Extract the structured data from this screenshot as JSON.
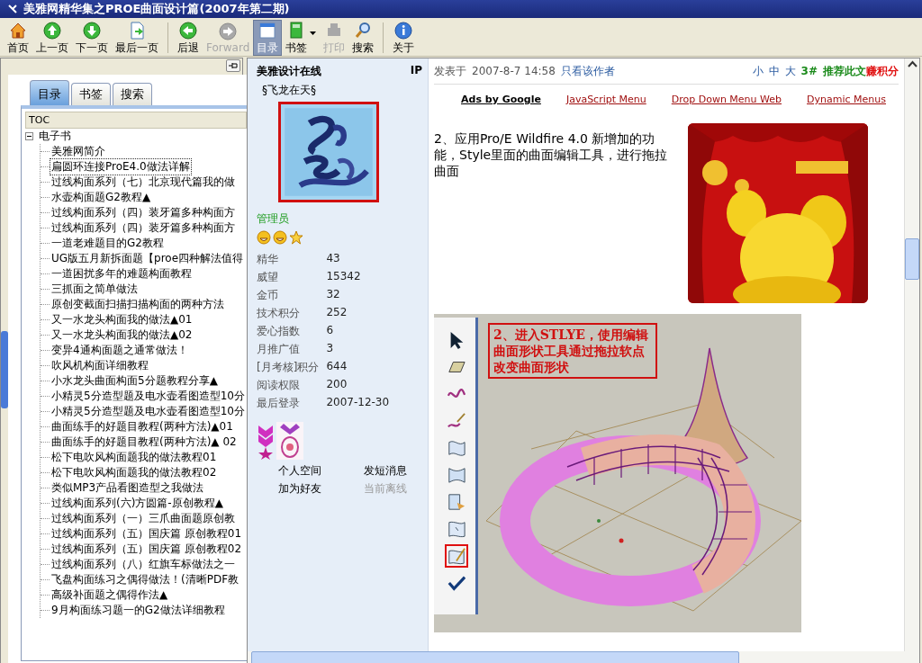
{
  "window": {
    "title": "美雅网精华集之PROE曲面设计篇(2007年第二期)"
  },
  "toolbar": [
    {
      "buttons": [
        {
          "label": "首页",
          "kind": "home",
          "disabled": false,
          "selected": false,
          "dropdown": false
        },
        {
          "label": "上一页",
          "kind": "up",
          "disabled": false,
          "selected": false,
          "dropdown": false
        },
        {
          "label": "下一页",
          "kind": "down",
          "disabled": false,
          "selected": false,
          "dropdown": false
        },
        {
          "label": "最后一页",
          "kind": "last",
          "disabled": false,
          "selected": false,
          "dropdown": false
        }
      ]
    },
    {
      "buttons": [
        {
          "label": "后退",
          "kind": "back",
          "disabled": false,
          "selected": false,
          "dropdown": false
        },
        {
          "label": "Forward",
          "kind": "forward",
          "disabled": true,
          "selected": false,
          "dropdown": false
        },
        {
          "label": "目录",
          "kind": "toc",
          "disabled": false,
          "selected": true,
          "dropdown": false
        },
        {
          "label": "书签",
          "kind": "bookmark",
          "disabled": false,
          "selected": false,
          "dropdown": true
        },
        {
          "label": "打印",
          "kind": "print",
          "disabled": true,
          "selected": false,
          "dropdown": false
        },
        {
          "label": "搜索",
          "kind": "search",
          "disabled": false,
          "selected": false,
          "dropdown": false
        }
      ]
    },
    {
      "buttons": [
        {
          "label": "关于",
          "kind": "about",
          "disabled": false,
          "selected": false,
          "dropdown": false
        }
      ]
    }
  ],
  "sidebar": {
    "tabs": [
      {
        "label": "目录",
        "selected": true
      },
      {
        "label": "书签",
        "selected": false
      },
      {
        "label": "搜索",
        "selected": false
      }
    ],
    "tree_header": "TOC",
    "tree": [
      {
        "label": "电子书",
        "expanded": true,
        "selected": false,
        "children": [
          {
            "label": "美雅网简介",
            "selected": false
          },
          {
            "label": "扁圆环连接ProE4.0做法详解",
            "selected": true
          },
          {
            "label": "过线构面系列（七）北京现代篇我的做",
            "selected": false
          },
          {
            "label": "水壶构面题G2教程▲",
            "selected": false
          },
          {
            "label": "过线构面系列（四）装牙篇多种构面方",
            "selected": false
          },
          {
            "label": "过线构面系列（四）装牙篇多种构面方",
            "selected": false
          },
          {
            "label": "一道老难题目的G2教程",
            "selected": false
          },
          {
            "label": "UG版五月新拆面题【proe四种解法值得",
            "selected": false
          },
          {
            "label": "一道困扰多年的难题构面教程",
            "selected": false
          },
          {
            "label": "三抓面之简单做法",
            "selected": false
          },
          {
            "label": "原创变截面扫描扫描构面的两种方法",
            "selected": false
          },
          {
            "label": "又一水龙头构面我的做法▲01",
            "selected": false
          },
          {
            "label": "又一水龙头构面我的做法▲02",
            "selected": false
          },
          {
            "label": "变异4通构面题之通常做法！",
            "selected": false
          },
          {
            "label": "吹风机构面详细教程",
            "selected": false
          },
          {
            "label": "小水龙头曲面构面5分题教程分享▲",
            "selected": false
          },
          {
            "label": "小精灵5分造型题及电水壶看图造型10分",
            "selected": false
          },
          {
            "label": "小精灵5分造型题及电水壶看图造型10分",
            "selected": false
          },
          {
            "label": "曲面练手的好题目教程(两种方法)▲01",
            "selected": false
          },
          {
            "label": "曲面练手的好题目教程(两种方法)▲ 02",
            "selected": false
          },
          {
            "label": "松下电吹风构面题我的做法教程01",
            "selected": false
          },
          {
            "label": "松下电吹风构面题我的做法教程02",
            "selected": false
          },
          {
            "label": "类似MP3产品看图造型之我做法",
            "selected": false
          },
          {
            "label": "过线构面系列(六)方圆篇-原创教程▲",
            "selected": false
          },
          {
            "label": "过线构面系列（一）三爪曲面题原创教",
            "selected": false
          },
          {
            "label": "过线构面系列（五）国庆篇 原创教程01",
            "selected": false
          },
          {
            "label": "过线构面系列（五）国庆篇 原创教程02",
            "selected": false
          },
          {
            "label": "过线构面系列（八）红旗车标做法之一",
            "selected": false
          },
          {
            "label": "飞盘构面练习之偶得做法！(清晰PDF教",
            "selected": false
          },
          {
            "label": "高级补面题之偶得作法▲",
            "selected": false
          },
          {
            "label": "9月构面练习题一的G2做法详细教程",
            "selected": false
          }
        ]
      }
    ]
  },
  "profile": {
    "site": "美雅设计在线",
    "ip": "IP",
    "username": "§飞龙在天§",
    "avatar": {
      "kind": "picture"
    },
    "role": "管理员",
    "stats": [
      {
        "label": "精华",
        "value": "43"
      },
      {
        "label": "威望",
        "value": "15342"
      },
      {
        "label": "金币",
        "value": "32"
      },
      {
        "label": "技术积分",
        "value": "252"
      },
      {
        "label": "爱心指数",
        "value": "6"
      },
      {
        "label": "月推广值",
        "value": "3"
      },
      {
        "label": "[月考核]积分",
        "value": "644"
      },
      {
        "label": "阅读权限",
        "value": "200"
      },
      {
        "label": "最后登录",
        "value": "2007-12-30"
      }
    ],
    "links": [
      {
        "label": "个人空间",
        "disabled": false
      },
      {
        "label": "发短消息",
        "disabled": false
      },
      {
        "label": "加为好友",
        "disabled": false
      },
      {
        "label": "当前离线",
        "disabled": true
      }
    ]
  },
  "post": {
    "posted_label": "发表于",
    "posted_time": "2007-8-7 14:58",
    "author_only": "只看该作者",
    "font_sizes": [
      "小",
      "中",
      "大"
    ],
    "floor": "3#",
    "recommend": "推荐此文",
    "earn": "赚积分",
    "ads": {
      "title": "Ads by Google",
      "links": [
        "JavaScript Menu",
        "Drop Down Menu Web",
        "Dynamic Menus"
      ]
    },
    "body": "2、应用Pro/E Wildfire 4.0 新增加的功能，Style里面的曲面编辑工具，进行拖拉曲面",
    "image": {
      "kind": "picture"
    },
    "screenshot": {
      "note": "2、进入STLYE，使用编辑曲面形状工具通过拖拉软点改变曲面形状",
      "palette": [
        {
          "kind": "pointer",
          "selected": false
        },
        {
          "kind": "plane",
          "selected": false
        },
        {
          "kind": "curve",
          "selected": false
        },
        {
          "kind": "curve-edit",
          "selected": false
        },
        {
          "kind": "surface",
          "selected": false
        },
        {
          "kind": "surface-connect",
          "selected": false
        },
        {
          "kind": "surface-trim",
          "selected": false
        },
        {
          "kind": "surface-edit",
          "selected": false
        },
        {
          "kind": "surface-drag",
          "selected": true
        },
        {
          "kind": "done",
          "selected": false
        }
      ]
    }
  }
}
